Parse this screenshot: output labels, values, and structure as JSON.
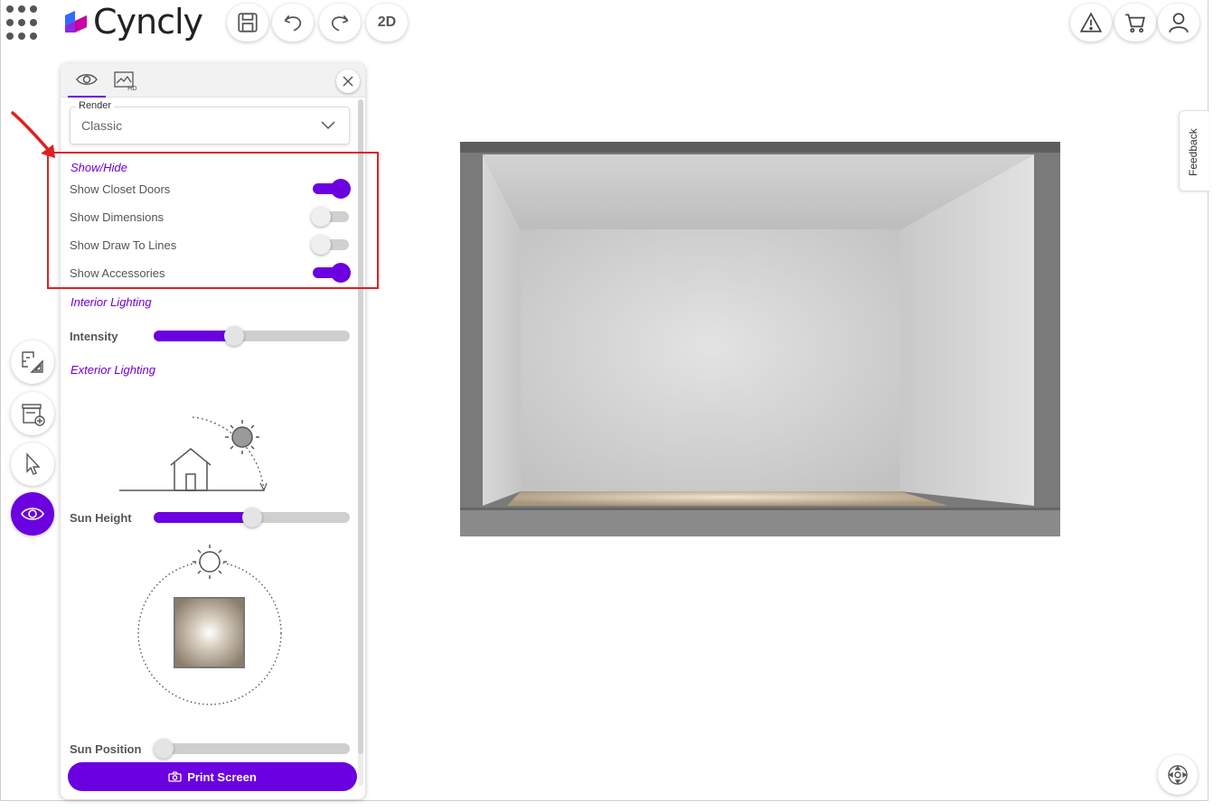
{
  "app": {
    "brand": "Cyncly",
    "toolbar": {
      "mode_label": "2D"
    }
  },
  "panel": {
    "render": {
      "label": "Render",
      "value": "Classic"
    },
    "show_hide": {
      "title": "Show/Hide",
      "items": [
        {
          "label": "Show Closet Doors",
          "on": true
        },
        {
          "label": "Show Dimensions",
          "on": false
        },
        {
          "label": "Show Draw To Lines",
          "on": false
        },
        {
          "label": "Show Accessories",
          "on": true
        }
      ]
    },
    "interior_lighting": {
      "title": "Interior Lighting",
      "intensity_label": "Intensity",
      "intensity_value": 0.41
    },
    "exterior_lighting": {
      "title": "Exterior Lighting",
      "sun_height_label": "Sun Height",
      "sun_height_value": 0.5,
      "sun_position_label": "Sun Position",
      "sun_position_value": 0.0
    },
    "print_label": "Print Screen"
  },
  "side": {
    "feedback_label": "Feedback"
  },
  "colors": {
    "accent": "#6b00e0",
    "highlight": "#e02020"
  },
  "icons": [
    "apps-grid-icon",
    "save-icon",
    "undo-icon",
    "redo-icon",
    "warning-icon",
    "cart-icon",
    "user-icon",
    "eye-icon",
    "hd-render-icon",
    "close-icon",
    "chevron-down-icon",
    "floorplan-icon",
    "add-cabinet-icon",
    "pointer-icon",
    "camera-icon",
    "navigate-icon",
    "sun-icon",
    "house-icon"
  ]
}
